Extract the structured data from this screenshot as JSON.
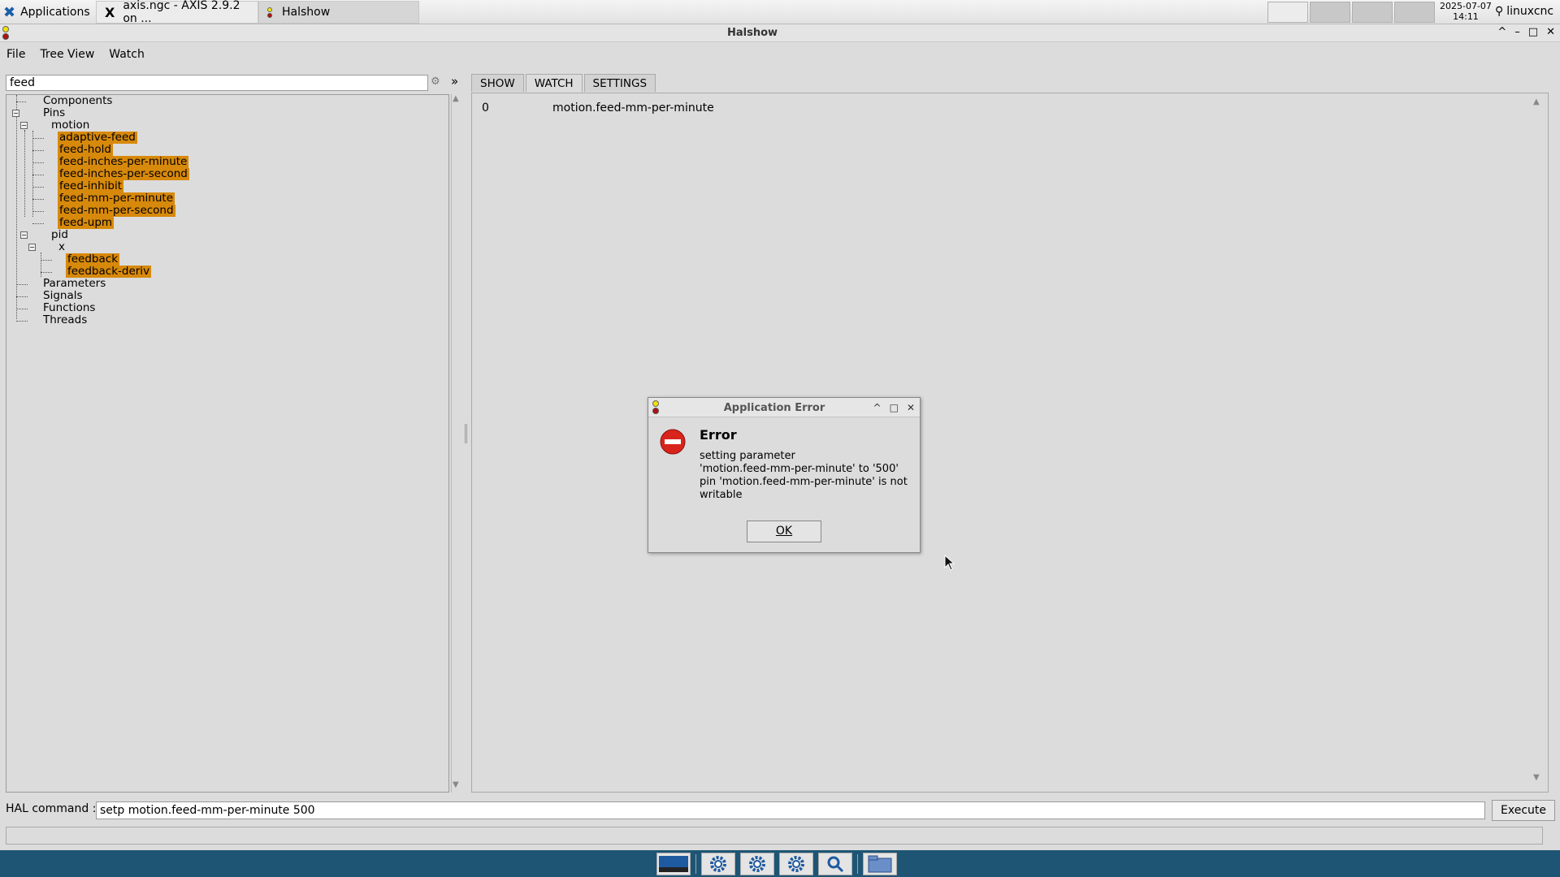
{
  "taskbar": {
    "applications_label": "Applications",
    "tasks": [
      {
        "label": "axis.ngc - AXIS 2.9.2 on ..."
      },
      {
        "label": "Halshow"
      }
    ],
    "clock_date": "2025-07-07",
    "clock_time": "14:11",
    "user_label": "linuxcnc"
  },
  "window": {
    "title": "Halshow",
    "controls": {
      "up": "^",
      "minimize": "–",
      "maximize": "□",
      "close": "✕"
    }
  },
  "menu": {
    "file": "File",
    "tree_view": "Tree View",
    "watch": "Watch"
  },
  "search": {
    "value": "feed",
    "expand_label": "»"
  },
  "tree": {
    "components": "Components",
    "pins": "Pins",
    "motion": "motion",
    "motion_pins": [
      "adaptive-feed",
      "feed-hold",
      "feed-inches-per-minute",
      "feed-inches-per-second",
      "feed-inhibit",
      "feed-mm-per-minute",
      "feed-mm-per-second",
      "feed-upm"
    ],
    "pid": "pid",
    "pid_x": "x",
    "pid_x_pins": [
      "feedback",
      "feedback-deriv"
    ],
    "parameters": "Parameters",
    "signals": "Signals",
    "functions": "Functions",
    "threads": "Threads",
    "highlight_color": "#d7890b"
  },
  "tabs": {
    "show": "SHOW",
    "watch": "WATCH",
    "settings": "SETTINGS",
    "active": "WATCH"
  },
  "watch": {
    "rows": [
      {
        "value": "0",
        "name": "motion.feed-mm-per-minute"
      }
    ]
  },
  "hal_command": {
    "label": "HAL command :",
    "value": "setp motion.feed-mm-per-minute 500",
    "execute_label": "Execute"
  },
  "dialog": {
    "title": "Application Error",
    "heading": "Error",
    "message": "setting parameter\n'motion.feed-mm-per-minute' to '500'\npin 'motion.feed-mm-per-minute' is not\nwritable",
    "ok_label": "OK",
    "icon": "error-stop-icon"
  },
  "colors": {
    "dock": "#1e5574",
    "error_red": "#d9241b",
    "highlight": "#d7890b"
  }
}
